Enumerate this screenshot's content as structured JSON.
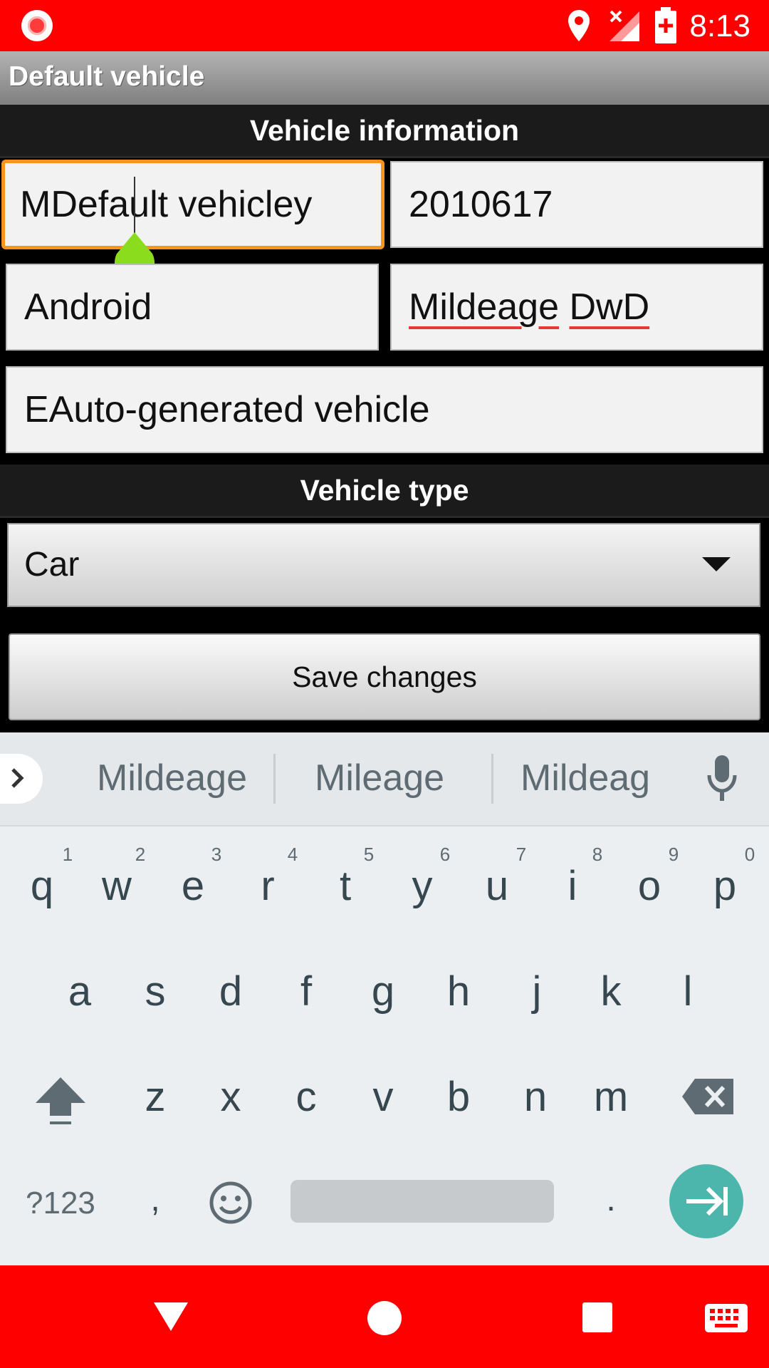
{
  "status_bar": {
    "time": "8:13",
    "icons": [
      "record-icon",
      "location-icon",
      "no-signal-icon",
      "battery-charging-icon"
    ]
  },
  "title_bar": {
    "title": "Default vehicle"
  },
  "vehicle_info": {
    "header": "Vehicle information",
    "name_value": "MDefault vehicley",
    "number_value": "2010617",
    "make_value": "Android",
    "mileage_word": "Mildeage",
    "mileage_word2": "DwD",
    "description_value": "EAuto-generated vehicle"
  },
  "vehicle_type": {
    "header": "Vehicle type",
    "selected": "Car"
  },
  "save_button": {
    "label": "Save changes"
  },
  "keyboard": {
    "suggestions": [
      "Mildeage",
      "Mileage",
      "Mildeag"
    ],
    "row1": [
      "q",
      "w",
      "e",
      "r",
      "t",
      "y",
      "u",
      "i",
      "o",
      "p"
    ],
    "row1_hints": [
      "1",
      "2",
      "3",
      "4",
      "5",
      "6",
      "7",
      "8",
      "9",
      "0"
    ],
    "row2": [
      "a",
      "s",
      "d",
      "f",
      "g",
      "h",
      "j",
      "k",
      "l"
    ],
    "row3": [
      "z",
      "x",
      "c",
      "v",
      "b",
      "n",
      "m"
    ],
    "symbols_label": "?123",
    "comma": ",",
    "period": "."
  },
  "colors": {
    "accent": "#ff0000",
    "focus_border": "#f7941e",
    "enter_key": "#4db6ac",
    "handle": "#8bdc1c"
  }
}
